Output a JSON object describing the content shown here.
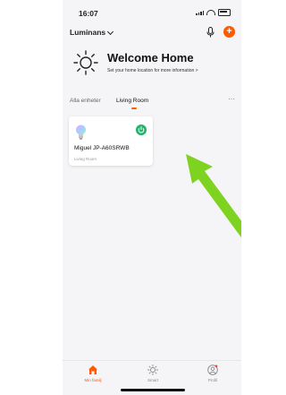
{
  "status_bar": {
    "time": "16:07",
    "icons": [
      "cellular-signal-icon",
      "wifi-icon",
      "battery-icon"
    ]
  },
  "header": {
    "home_name": "Luminans",
    "icons": [
      "chevron-down-icon",
      "microphone-icon",
      "add-icon"
    ],
    "add_symbol": "+",
    "accent_color": "#ff5a00"
  },
  "welcome": {
    "title": "Welcome Home",
    "subtitle": "Set your home location for more information",
    "subtitle_arrow": ">",
    "icon": "sun-icon"
  },
  "tabs": {
    "items": [
      {
        "label": "Alla enheter",
        "active": false
      },
      {
        "label": "Living Room",
        "active": true
      }
    ],
    "more_symbol": "···"
  },
  "devices": [
    {
      "name": "Miguel JP-A60SRWB",
      "room": "Living Room",
      "icon": "light-bulb-icon",
      "power_on": true,
      "power_color": "#27b36b"
    }
  ],
  "annotation": {
    "arrow_color": "#7ed321",
    "icon": "arrow-pointer-icon"
  },
  "bottom_nav": {
    "items": [
      {
        "label": "Min familj",
        "icon": "home-icon",
        "active": true
      },
      {
        "label": "Smart",
        "icon": "sun-icon",
        "active": false
      },
      {
        "label": "Profil",
        "icon": "profile-icon",
        "active": false
      }
    ]
  }
}
